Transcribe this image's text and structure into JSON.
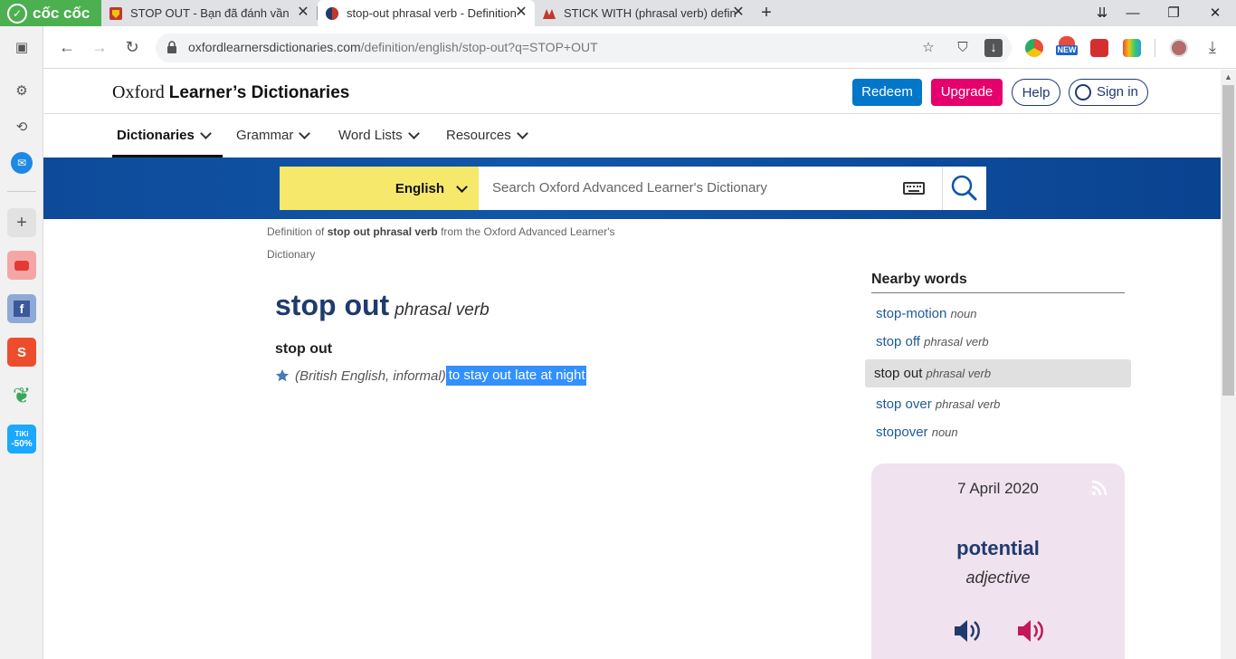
{
  "browser": {
    "brand": "cốc cốc",
    "tabs": [
      {
        "title": "STOP OUT - Bạn đã đánh vần"
      },
      {
        "title": "stop-out phrasal verb - Definition"
      },
      {
        "title": "STICK WITH (phrasal verb) definition"
      }
    ],
    "url_host": "oxfordlearnersdictionaries.com",
    "url_path": "/definition/english/stop-out?q=STOP+OUT",
    "ext_badge": "NEW",
    "sidebar_badge": "-50%",
    "sidebar_tiki": "TiKi"
  },
  "site": {
    "logo_prefix": "Oxford",
    "logo_main": "Learner’s Dictionaries",
    "buttons": {
      "redeem": "Redeem",
      "upgrade": "Upgrade",
      "help": "Help",
      "signin": "Sign in"
    },
    "menu": [
      "Dictionaries",
      "Grammar",
      "Word Lists",
      "Resources"
    ],
    "search": {
      "language": "English",
      "placeholder": "Search Oxford Advanced Learner's Dictionary"
    }
  },
  "entry": {
    "crumb_prefix": "Definition of",
    "crumb_term": "stop out phrasal verb",
    "crumb_suffix": "from the Oxford Advanced Learner's Dictionary",
    "headword": "stop out",
    "pos": "phrasal verb",
    "subhead": "stop out",
    "label": "(British English, informal)",
    "definition": "to stay out late at night"
  },
  "nearby": {
    "title": "Nearby words",
    "items": [
      {
        "word": "stop-motion",
        "pos": "noun"
      },
      {
        "word": "stop off",
        "pos": "phrasal verb"
      },
      {
        "word": "stop out",
        "pos": "phrasal verb",
        "selected": true
      },
      {
        "word": "stop over",
        "pos": "phrasal verb"
      },
      {
        "word": "stopover",
        "pos": "noun"
      }
    ]
  },
  "wotd": {
    "date": "7 April 2020",
    "word": "potential",
    "pos": "adjective"
  },
  "colors": {
    "brand_blue": "#1156a8",
    "search_yellow": "#f5e86a",
    "redeem": "#0077c8",
    "upgrade": "#e5006d",
    "headword": "#1f3b6e",
    "selection": "#3390ff",
    "wotd_bg": "#f0e2ee"
  }
}
